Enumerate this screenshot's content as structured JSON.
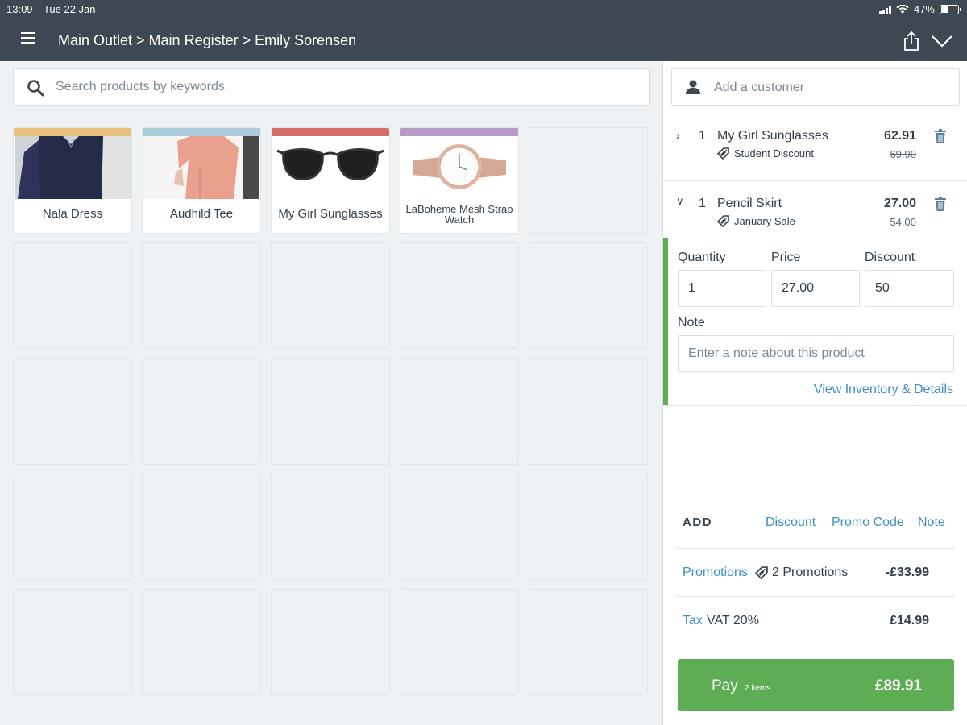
{
  "status_bar": {
    "time": "13:09",
    "date": "Tue 22 Jan",
    "battery": "47%",
    "battery_level": 0.47
  },
  "header": {
    "breadcrumb": "Main Outlet > Main Register > Emily Sorensen"
  },
  "search": {
    "placeholder": "Search products by keywords"
  },
  "products": [
    {
      "name": "Nala Dress",
      "color": "#e9c07d"
    },
    {
      "name": "Audhild Tee",
      "color": "#a9ccd8"
    },
    {
      "name": "My Girl Sunglasses",
      "color": "#d26e66"
    },
    {
      "name": "LaBoheme Mesh Strap Watch",
      "color": "#b79ac6"
    }
  ],
  "customer": {
    "placeholder": "Add a customer"
  },
  "cart": {
    "items": [
      {
        "qty": "1",
        "name": "My Girl Sunglasses",
        "price": "62.91",
        "old_price": "69.90",
        "promo": "Student Discount"
      },
      {
        "qty": "1",
        "name": "Pencil Skirt",
        "price": "27.00",
        "old_price": "54.00",
        "promo": "January Sale"
      }
    ],
    "editor": {
      "quantity_label": "Quantity",
      "quantity": "1",
      "price_label": "Price",
      "price": "27.00",
      "discount_label": "Discount",
      "discount": "50",
      "note_label": "Note",
      "note_placeholder": "Enter a note about this product",
      "inventory_link": "View Inventory & Details"
    }
  },
  "add": {
    "label": "ADD",
    "discount": "Discount",
    "promo_code": "Promo Code",
    "note": "Note"
  },
  "summary": {
    "promotions_link": "Promotions",
    "promotions_text": "2 Promotions",
    "promotions_amount": "-£33.99",
    "tax_link": "Tax",
    "tax_text": "VAT 20%",
    "tax_amount": "£14.99"
  },
  "pay": {
    "label": "Pay",
    "items": "2 items",
    "total": "£89.91"
  },
  "colors": {
    "header": "#3e4852",
    "accent_green": "#5cad53",
    "link_blue": "#3d8fc9"
  }
}
